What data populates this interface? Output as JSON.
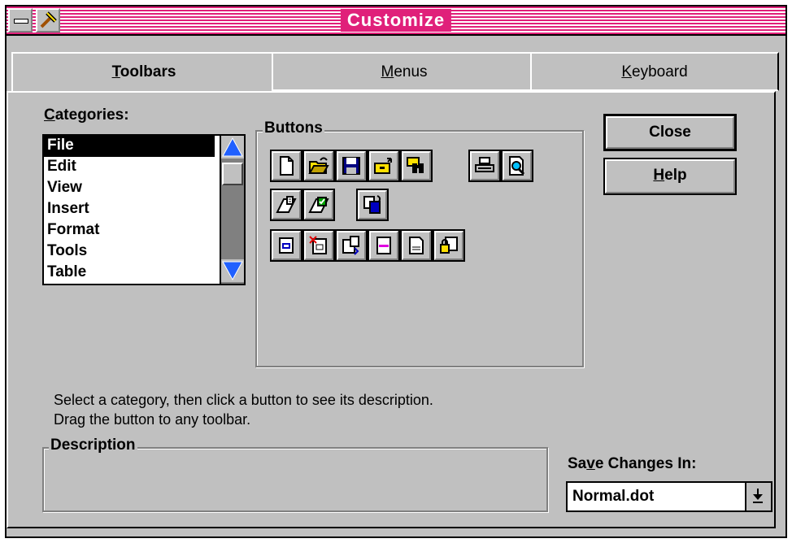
{
  "window": {
    "title": "Customize"
  },
  "tabs": [
    {
      "label": "Toolbars",
      "accel": "T",
      "rest": "oolbars",
      "active": true
    },
    {
      "label": "Menus",
      "accel": "M",
      "rest": "enus",
      "active": false
    },
    {
      "label": "Keyboard",
      "accel": "K",
      "rest": "eyboard",
      "active": false
    }
  ],
  "categories": {
    "label_accel": "C",
    "label_rest": "ategories:",
    "items": [
      "File",
      "Edit",
      "View",
      "Insert",
      "Format",
      "Tools",
      "Table"
    ],
    "selected": "File"
  },
  "buttons_group": {
    "label": "Buttons",
    "rows": [
      [
        "new-document-icon",
        "open-folder-icon",
        "save-disk-icon",
        "open-drawer-icon",
        "find-file-binoculars-icon",
        "print-icon",
        "print-preview-icon"
      ],
      [
        "envelope-icon",
        "mail-merge-icon",
        "copy-paste-icon"
      ],
      [
        "small-document-icon",
        "delete-document-icon",
        "insert-file-icon",
        "insert-header-icon",
        "insert-footer-icon",
        "lock-document-icon"
      ]
    ]
  },
  "actions": {
    "close_label": "Close",
    "help_accel": "H",
    "help_rest": "elp"
  },
  "info": {
    "line1": "Select a category, then click a button to see its description.",
    "line2": "Drag the button to any toolbar."
  },
  "description": {
    "label": "Description",
    "text": ""
  },
  "save_changes": {
    "label_pre": "Sa",
    "label_accel": "v",
    "label_post": "e Changes In:",
    "value": "Normal.dot"
  },
  "colors": {
    "title_bar": "#e0207a",
    "face": "#c0c0c0",
    "scroll_arrow": "#2060ff"
  }
}
